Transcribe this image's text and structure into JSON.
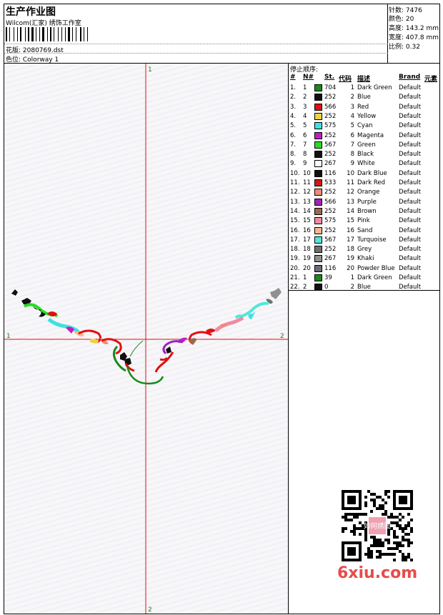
{
  "header": {
    "title": "生产作业图",
    "subtitle": "Wilcom(汇家) 绣饰工作室",
    "file_label": "花版: 2080769.dst",
    "colorway_label": "色位: Colorway 1"
  },
  "stats": {
    "stitches": "针数: 7476",
    "colors": "颜色: 20",
    "height": "高度: 143.2 mm",
    "width": "宽度: 407.8 mm",
    "scale": "比例: 0.32"
  },
  "canvas": {
    "axis_top": "1",
    "axis_bottom": "2",
    "axis_left": "1",
    "axis_right": "2"
  },
  "stops": {
    "title": "停止顺序:",
    "columns": [
      "#",
      "N#",
      "St.",
      "代码",
      "描述",
      "Brand",
      "元素"
    ],
    "rows": [
      {
        "idx": "1.",
        "n": "1",
        "color": "#1a8a1a",
        "st": "704",
        "code": "1",
        "desc": "Dark Green",
        "brand": "Default"
      },
      {
        "idx": "2.",
        "n": "2",
        "color": "#111111",
        "st": "252",
        "code": "2",
        "desc": "Blue",
        "brand": "Default"
      },
      {
        "idx": "3.",
        "n": "3",
        "color": "#e01010",
        "st": "566",
        "code": "3",
        "desc": "Red",
        "brand": "Default"
      },
      {
        "idx": "4.",
        "n": "4",
        "color": "#f2d040",
        "st": "252",
        "code": "4",
        "desc": "Yellow",
        "brand": "Default"
      },
      {
        "idx": "5.",
        "n": "5",
        "color": "#40e0e0",
        "st": "575",
        "code": "5",
        "desc": "Cyan",
        "brand": "Default"
      },
      {
        "idx": "6.",
        "n": "6",
        "color": "#c020c0",
        "st": "252",
        "code": "6",
        "desc": "Magenta",
        "brand": "Default"
      },
      {
        "idx": "7.",
        "n": "7",
        "color": "#20e020",
        "st": "567",
        "code": "7",
        "desc": "Green",
        "brand": "Default"
      },
      {
        "idx": "8.",
        "n": "8",
        "color": "#111111",
        "st": "252",
        "code": "8",
        "desc": "Black",
        "brand": "Default"
      },
      {
        "idx": "9.",
        "n": "9",
        "color": "#f8f8f8",
        "st": "267",
        "code": "9",
        "desc": "White",
        "brand": "Default"
      },
      {
        "idx": "10.",
        "n": "10",
        "color": "#111111",
        "st": "116",
        "code": "10",
        "desc": "Dark Blue",
        "brand": "Default"
      },
      {
        "idx": "11.",
        "n": "11",
        "color": "#d01818",
        "st": "533",
        "code": "11",
        "desc": "Dark Red",
        "brand": "Default"
      },
      {
        "idx": "12.",
        "n": "12",
        "color": "#f08a70",
        "st": "252",
        "code": "12",
        "desc": "Orange",
        "brand": "Default"
      },
      {
        "idx": "13.",
        "n": "13",
        "color": "#a020c0",
        "st": "566",
        "code": "13",
        "desc": "Purple",
        "brand": "Default"
      },
      {
        "idx": "14.",
        "n": "14",
        "color": "#9a6a4a",
        "st": "252",
        "code": "14",
        "desc": "Brown",
        "brand": "Default"
      },
      {
        "idx": "15.",
        "n": "15",
        "color": "#f08aa0",
        "st": "575",
        "code": "15",
        "desc": "Pink",
        "brand": "Default"
      },
      {
        "idx": "16.",
        "n": "16",
        "color": "#f2b890",
        "st": "252",
        "code": "16",
        "desc": "Sand",
        "brand": "Default"
      },
      {
        "idx": "17.",
        "n": "17",
        "color": "#50e8d8",
        "st": "567",
        "code": "17",
        "desc": "Turquoise",
        "brand": "Default"
      },
      {
        "idx": "18.",
        "n": "18",
        "color": "#707070",
        "st": "252",
        "code": "18",
        "desc": "Grey",
        "brand": "Default"
      },
      {
        "idx": "19.",
        "n": "19",
        "color": "#909090",
        "st": "267",
        "code": "19",
        "desc": "Khaki",
        "brand": "Default"
      },
      {
        "idx": "20.",
        "n": "20",
        "color": "#6a6a7a",
        "st": "116",
        "code": "20",
        "desc": "Powder Blue",
        "brand": "Default"
      },
      {
        "idx": "21.",
        "n": "1",
        "color": "#1a8a1a",
        "st": "39",
        "code": "1",
        "desc": "Dark Green",
        "brand": "Default"
      },
      {
        "idx": "22.",
        "n": "2",
        "color": "#111111",
        "st": "0",
        "code": "2",
        "desc": "Blue",
        "brand": "Default"
      }
    ]
  },
  "watermark": "6xiu.com",
  "qr_center_text": "如何绣图"
}
